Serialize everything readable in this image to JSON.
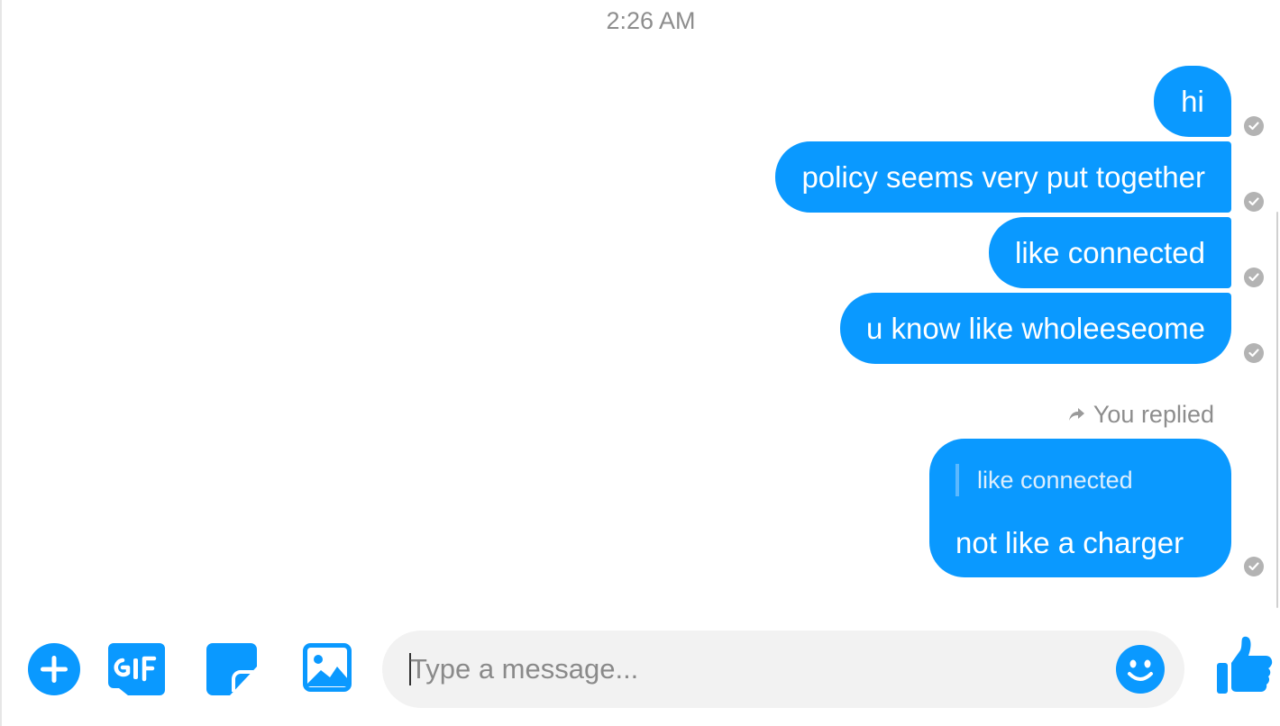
{
  "conversation": {
    "timestamp": "2:26 AM",
    "messages": [
      {
        "text": "hi"
      },
      {
        "text": "policy seems very put together"
      },
      {
        "text": "like connected"
      },
      {
        "text": "u know like wholeeseome"
      }
    ],
    "reply": {
      "label": "You replied",
      "quoted_text": "like connected",
      "text": "not like a charger"
    }
  },
  "composer": {
    "placeholder": "Type a message...",
    "value": ""
  },
  "icons": {
    "plus": "plus-circle-icon",
    "gif": "gif-icon",
    "sticker": "sticker-icon",
    "image": "image-icon",
    "emoji": "smiley-icon",
    "like": "thumbs-up-icon",
    "receipt": "check-circle-icon",
    "reply": "reply-arrow-icon"
  },
  "colors": {
    "accent": "#0a99ff",
    "receipt": "#b3b3b3",
    "input_bg": "#f2f2f2",
    "meta_text": "#8d8d8d"
  }
}
